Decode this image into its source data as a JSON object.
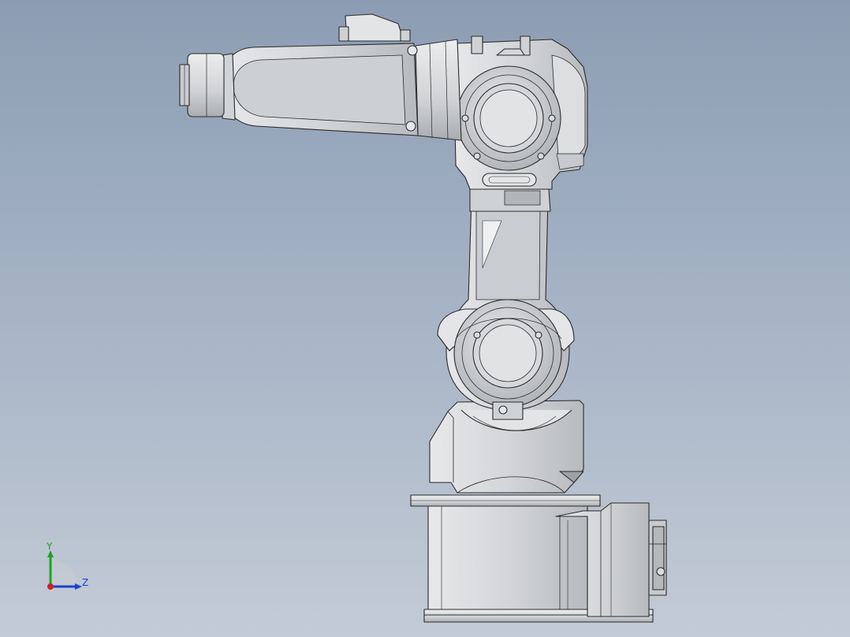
{
  "viewport": {
    "background_top": "#8c9db3",
    "background_bottom": "#c3cbd6"
  },
  "model": {
    "body_color": "#d9dbde",
    "body_shade": "#b9bcc0",
    "edge_color": "#2b2b2b"
  },
  "triad": {
    "y_label": "Y",
    "z_label": "Z",
    "y_color": "#1aa51a",
    "z_color": "#1f3fd1",
    "x_color": "#d11f1f"
  }
}
